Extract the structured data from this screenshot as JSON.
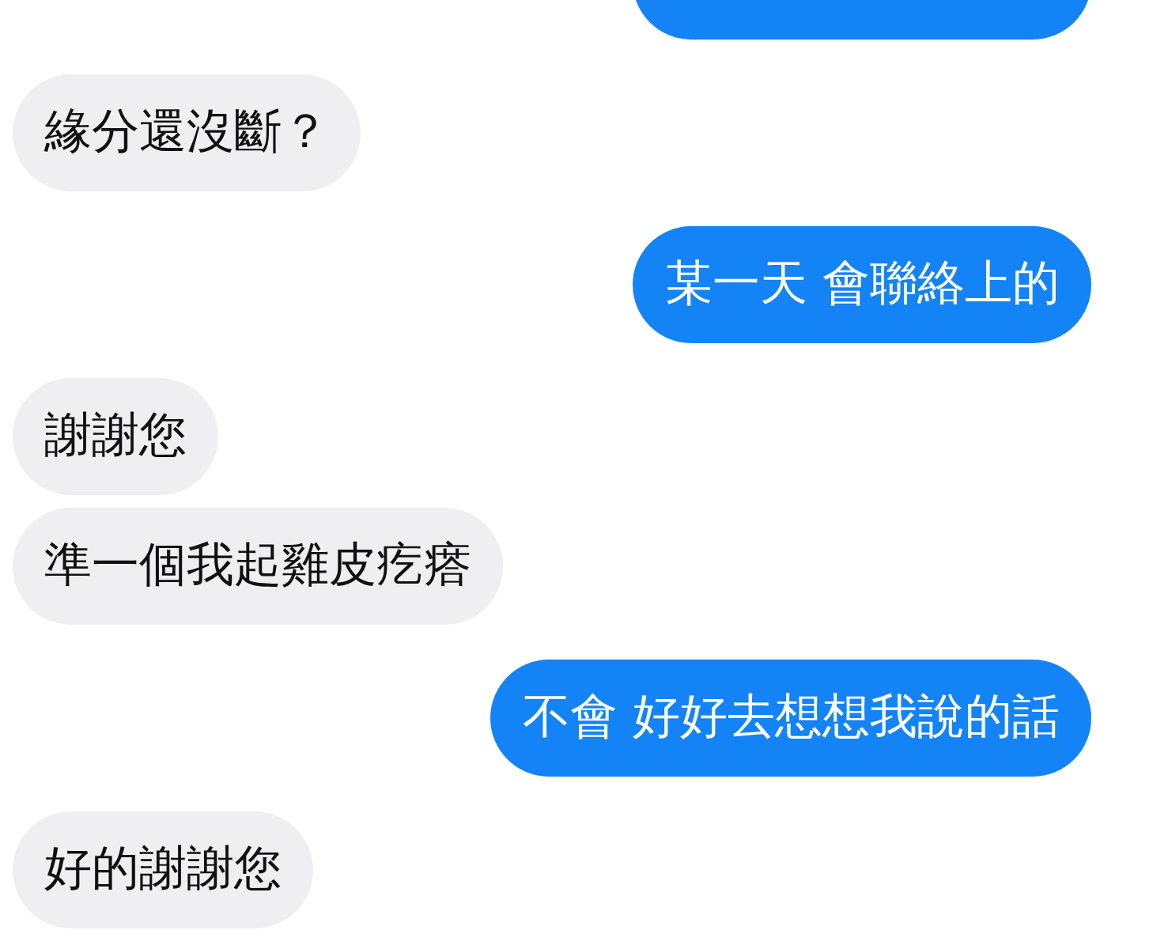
{
  "messages": [
    {
      "outgoing": true,
      "kind": "cut"
    },
    {
      "outgoing": false,
      "kind": "text",
      "text": "緣分還沒斷？"
    },
    {
      "outgoing": true,
      "kind": "text",
      "text": "某一天 會聯絡上的"
    },
    {
      "outgoing": false,
      "kind": "text",
      "text": "謝謝您"
    },
    {
      "outgoing": false,
      "kind": "text",
      "text": "準一個我起雞皮疙瘩"
    },
    {
      "outgoing": true,
      "kind": "text",
      "text": "不會 好好去想想我說的話"
    },
    {
      "outgoing": false,
      "kind": "text",
      "text": "好的謝謝您"
    }
  ]
}
